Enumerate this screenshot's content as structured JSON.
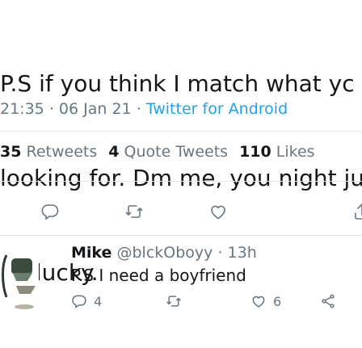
{
  "tweet": {
    "text_lines": [
      "P.S if you think I match what yc",
      "looking for. Dm me, you night ju",
      "be lucky."
    ],
    "time": "21:35",
    "date": "06 Jan 21",
    "source": "Twitter for Android",
    "separator": "·"
  },
  "stats": {
    "retweets_count": "35",
    "retweets_label": "Retweets",
    "quote_count": "4",
    "quote_label": "Quote Tweets",
    "likes_count": "110",
    "likes_label": "Likes"
  },
  "reply": {
    "name": "Mike",
    "handle": "@blckOboyy",
    "separator": "·",
    "time": "13h",
    "text": "P.S I need a boyfriend",
    "reply_count": "4",
    "like_count": "6"
  },
  "colors": {
    "accent": "#1da1f2",
    "muted": "#657786",
    "text": "#14171a",
    "divider": "#e1e8ed"
  },
  "icons": [
    "reply-icon",
    "retweet-icon",
    "like-icon",
    "share-icon"
  ]
}
